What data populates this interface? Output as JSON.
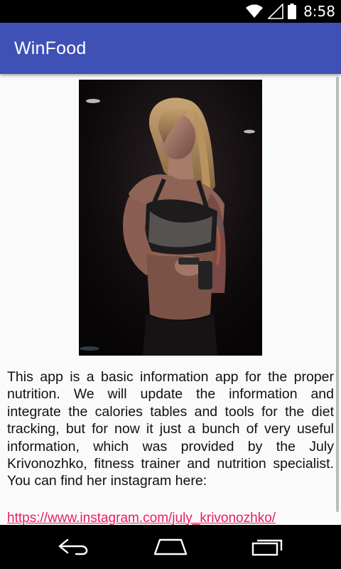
{
  "status_bar": {
    "time": "8:58",
    "icons": [
      "wifi-icon",
      "signal-icon",
      "battery-icon"
    ]
  },
  "app_bar": {
    "title": "WinFood",
    "color": "#3f51b5"
  },
  "content": {
    "image": "fitness-trainer-photo",
    "description": "This app is a basic information app for the proper nutrition. We will update the information and integrate the calories tables and tools for the diet tracking, but for now it just a bunch of very useful information, which was provided by the July Krivonozhko, fitness trainer and nutrition specialist. You can find her instagram here:",
    "link": "https://www.instagram.com/july_krivonozhko/",
    "link_color": "#e91e63"
  },
  "nav_bar": {
    "buttons": [
      "back-icon",
      "home-icon",
      "recents-icon"
    ]
  }
}
